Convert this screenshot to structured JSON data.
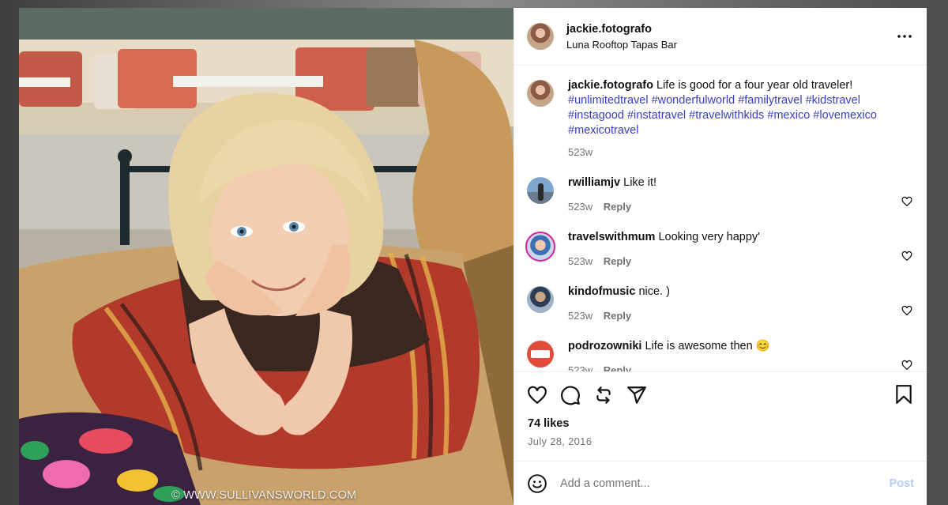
{
  "post": {
    "owner": {
      "username": "jackie.fotografo",
      "location": "Luna Rooftop Tapas Bar"
    },
    "caption": {
      "username": "jackie.fotografo",
      "text": "Life is good for a four year old traveler!",
      "hashtags": "#unlimitedtravel #wonderfulworld #familytravel #kidstravel #instagood #instatravel #travelwithkids #mexico #lovemexico #mexicotravel",
      "time": "523w"
    },
    "photo": {
      "watermark": "© WWW.SULLIVANSWORLD.COM"
    },
    "comments": [
      {
        "username": "rwilliamjv",
        "text": "Like it!",
        "time": "523w",
        "reply": "Reply"
      },
      {
        "username": "travelswithmum",
        "text": "Looking very happy'",
        "time": "523w",
        "reply": "Reply"
      },
      {
        "username": "kindofmusic",
        "text": "nice. )",
        "time": "523w",
        "reply": "Reply"
      },
      {
        "username": "podrozowniki",
        "text": "Life is awesome then 😊",
        "time": "523w",
        "reply": "Reply"
      }
    ],
    "likes": "74 likes",
    "date": "July 28, 2016",
    "add_comment": {
      "placeholder": "Add a comment...",
      "post_label": "Post"
    }
  },
  "icons": {
    "more": "more-horizontal-icon",
    "like": "heart-icon",
    "comment": "comment-bubble-icon",
    "repost": "repost-icon",
    "share": "paper-plane-icon",
    "save": "bookmark-icon",
    "emoji": "smiley-icon"
  },
  "colors": {
    "hashtag": "#3a3fbf",
    "muted": "#737373",
    "post_button_disabled": "#b3cdf5"
  }
}
